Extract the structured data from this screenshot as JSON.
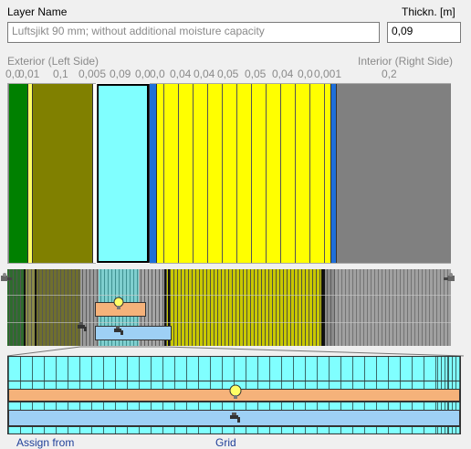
{
  "header": {
    "layer_name_label": "Layer Name",
    "thickness_label": "Thickn. [m]",
    "layer_name_value": "Luftsjikt 90 mm; without additional moisture capacity",
    "thickness_value": "0,09"
  },
  "axis": {
    "exterior_label": "Exterior (Left Side)",
    "interior_label": "Interior (Right Side)",
    "ticks": [
      "0,0",
      "0,01",
      "0,1",
      "0,005",
      "0,09",
      "0,0",
      "0,0",
      "0,04",
      "0,04",
      "0,05",
      "0,05",
      "0,04",
      "0,0",
      "0,001",
      "0,2"
    ]
  },
  "layers": [
    {
      "name": "layer-1",
      "color": "#008000"
    },
    {
      "name": "layer-2",
      "color": "#ffff66"
    },
    {
      "name": "layer-3",
      "color": "#808000"
    },
    {
      "name": "layer-4",
      "color": "#ffffff"
    },
    {
      "name": "layer-5",
      "color": "#80ffff",
      "selected": true
    },
    {
      "name": "layer-6",
      "color": "#1e6fd9"
    },
    {
      "name": "layer-7",
      "color": "#ffff00"
    },
    {
      "name": "layer-8",
      "color": "#1e6fd9"
    },
    {
      "name": "layer-9",
      "color": "#808080"
    }
  ],
  "colors": {
    "grid_background": "#888888",
    "detail_cyan": "#80ffff",
    "source_orange": "#f5b27a",
    "sink_blue": "#9ed0f5"
  },
  "icons": {
    "left_boundary": "faucet-icon",
    "right_boundary": "faucet-icon",
    "heat_source": "lightbulb-icon",
    "moisture_source": "water-tap-icon"
  },
  "footer": {
    "assign_link": "Assign from",
    "grid_link": "Grid"
  }
}
